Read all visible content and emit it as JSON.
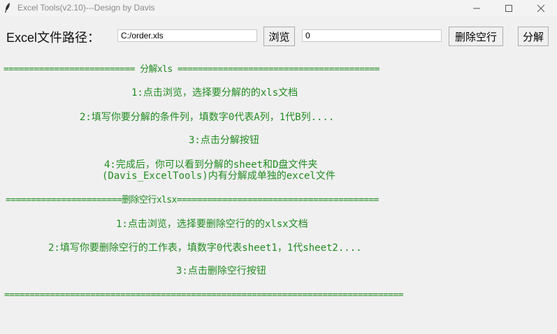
{
  "window": {
    "title": "Excel Tools(v2.10)---Design by Davis"
  },
  "toolbar": {
    "path_label": "Excel文件路径：",
    "path_value": "C:/order.xls",
    "browse_label": "浏览",
    "column_value": "0",
    "delete_blank_label": "删除空行",
    "split_label": "分解"
  },
  "instructions": {
    "split_header": "========================== 分解xls ========================================",
    "split_step1": "1:点击浏览，选择要分解的的xls文档",
    "split_step2": "2:填写你要分解的条件列，填数字0代表A列，1代B列....",
    "split_step3": "3:点击分解按钮",
    "split_step4a": "4:完成后，你可以看到分解的sheet和D盘文件夹",
    "split_step4b": "(Davis_ExcelTools)内有分解成单独的excel文件",
    "delete_header": "=======================删除空行xlsx========================================",
    "delete_step1": "1:点击浏览，选择要删除空行的的xlsx文档",
    "delete_step2": "2:填写你要删除空行的工作表，填数字0代表sheet1，1代sheet2....",
    "delete_step3": "3:点击删除空行按钮",
    "footer_line": "==============================================================================="
  }
}
